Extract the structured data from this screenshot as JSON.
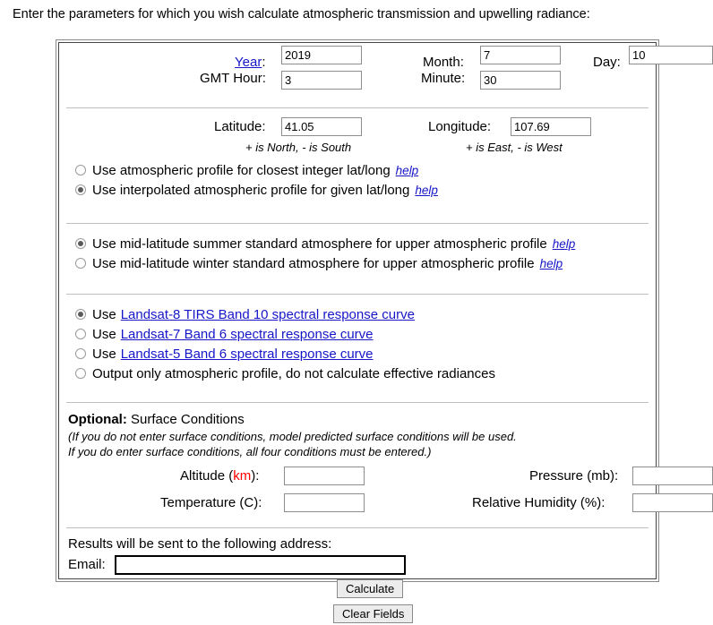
{
  "intro": "Enter the parameters for which you wish calculate atmospheric transmission and upwelling radiance:",
  "datetime": {
    "year_label": "Year",
    "year_value": "2019",
    "month_label": "Month:",
    "month_value": "7",
    "day_label": "Day:",
    "day_value": "10",
    "gmt_label": "GMT Hour:",
    "gmt_value": "3",
    "minute_label": "Minute:",
    "minute_value": "30"
  },
  "location": {
    "lat_label": "Latitude:",
    "lat_value": "41.05",
    "lon_label": "Longitude:",
    "lon_value": "107.69",
    "lat_note": "+ is North, - is South",
    "lon_note": "+ is East, - is West",
    "profile_options": [
      {
        "label": "Use atmospheric profile for closest integer lat/long",
        "help": "help",
        "selected": false
      },
      {
        "label": "Use interpolated atmospheric profile for given lat/long",
        "help": "help",
        "selected": true
      }
    ]
  },
  "standard_atmosphere": {
    "options": [
      {
        "label": "Use mid-latitude summer standard atmosphere for upper atmospheric profile",
        "help": "help",
        "selected": true
      },
      {
        "label": "Use mid-latitude winter standard atmosphere for upper atmospheric profile",
        "help": "help",
        "selected": false
      }
    ]
  },
  "spectral_response": {
    "options": [
      {
        "prefix": "Use",
        "link": "Landsat-8 TIRS Band 10 spectral response curve",
        "selected": true
      },
      {
        "prefix": "Use",
        "link": "Landsat-7 Band 6 spectral response curve",
        "selected": false
      },
      {
        "prefix": "Use",
        "link": "Landsat-5 Band 6 spectral response curve",
        "selected": false
      },
      {
        "prefix": "Output only atmospheric profile, do not calculate effective radiances",
        "link": "",
        "selected": false
      }
    ]
  },
  "surface": {
    "heading_bold": "Optional:",
    "heading_rest": " Surface Conditions",
    "note_line1": "(If you do not enter surface conditions, model predicted surface conditions will be used.",
    "note_line2": "If you do enter surface conditions, all four conditions must be entered.)",
    "altitude_label_pre": "Altitude (",
    "altitude_label_unit": "km",
    "altitude_label_post": "):",
    "altitude_value": "",
    "pressure_label": "Pressure (mb):",
    "pressure_value": "",
    "temperature_label": "Temperature (C):",
    "temperature_value": "",
    "humidity_label": "Relative Humidity (%):",
    "humidity_value": ""
  },
  "email_section": {
    "note": "Results will be sent to the following address:",
    "email_label": "Email:",
    "email_value": "",
    "calculate_label": "Calculate",
    "clear_label": "Clear Fields"
  },
  "colors": {
    "link": "#1616c8",
    "accent_red": "#ff0000",
    "border": "#8a8a8a"
  }
}
